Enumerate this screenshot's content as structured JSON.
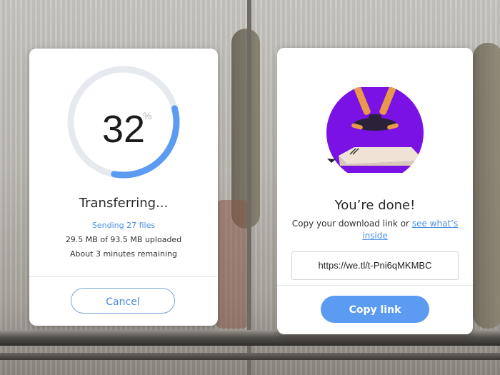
{
  "transfer_card": {
    "progress_percent": 32,
    "progress_value": "32",
    "percent_sign": "%",
    "title": "Transferring...",
    "files_link": "Sending 27 files",
    "size_text": "29.5 MB of 93.5 MB uploaded",
    "time_text": "About 3 minutes remaining",
    "cancel_label": "Cancel"
  },
  "done_card": {
    "title": "You’re done!",
    "description": "Copy your download link or",
    "see_link": "see what’s inside",
    "link_value": "https://we.tl/t-Pni6qMKMBC",
    "copy_label": "Copy link"
  },
  "colors": {
    "accent": "#4a90e2",
    "button_fill": "#5b9cf2",
    "illustration_bg": "#7a12e6",
    "ring_track": "#e6e9ee"
  },
  "icons": [
    "progress-ring",
    "done-illustration"
  ]
}
